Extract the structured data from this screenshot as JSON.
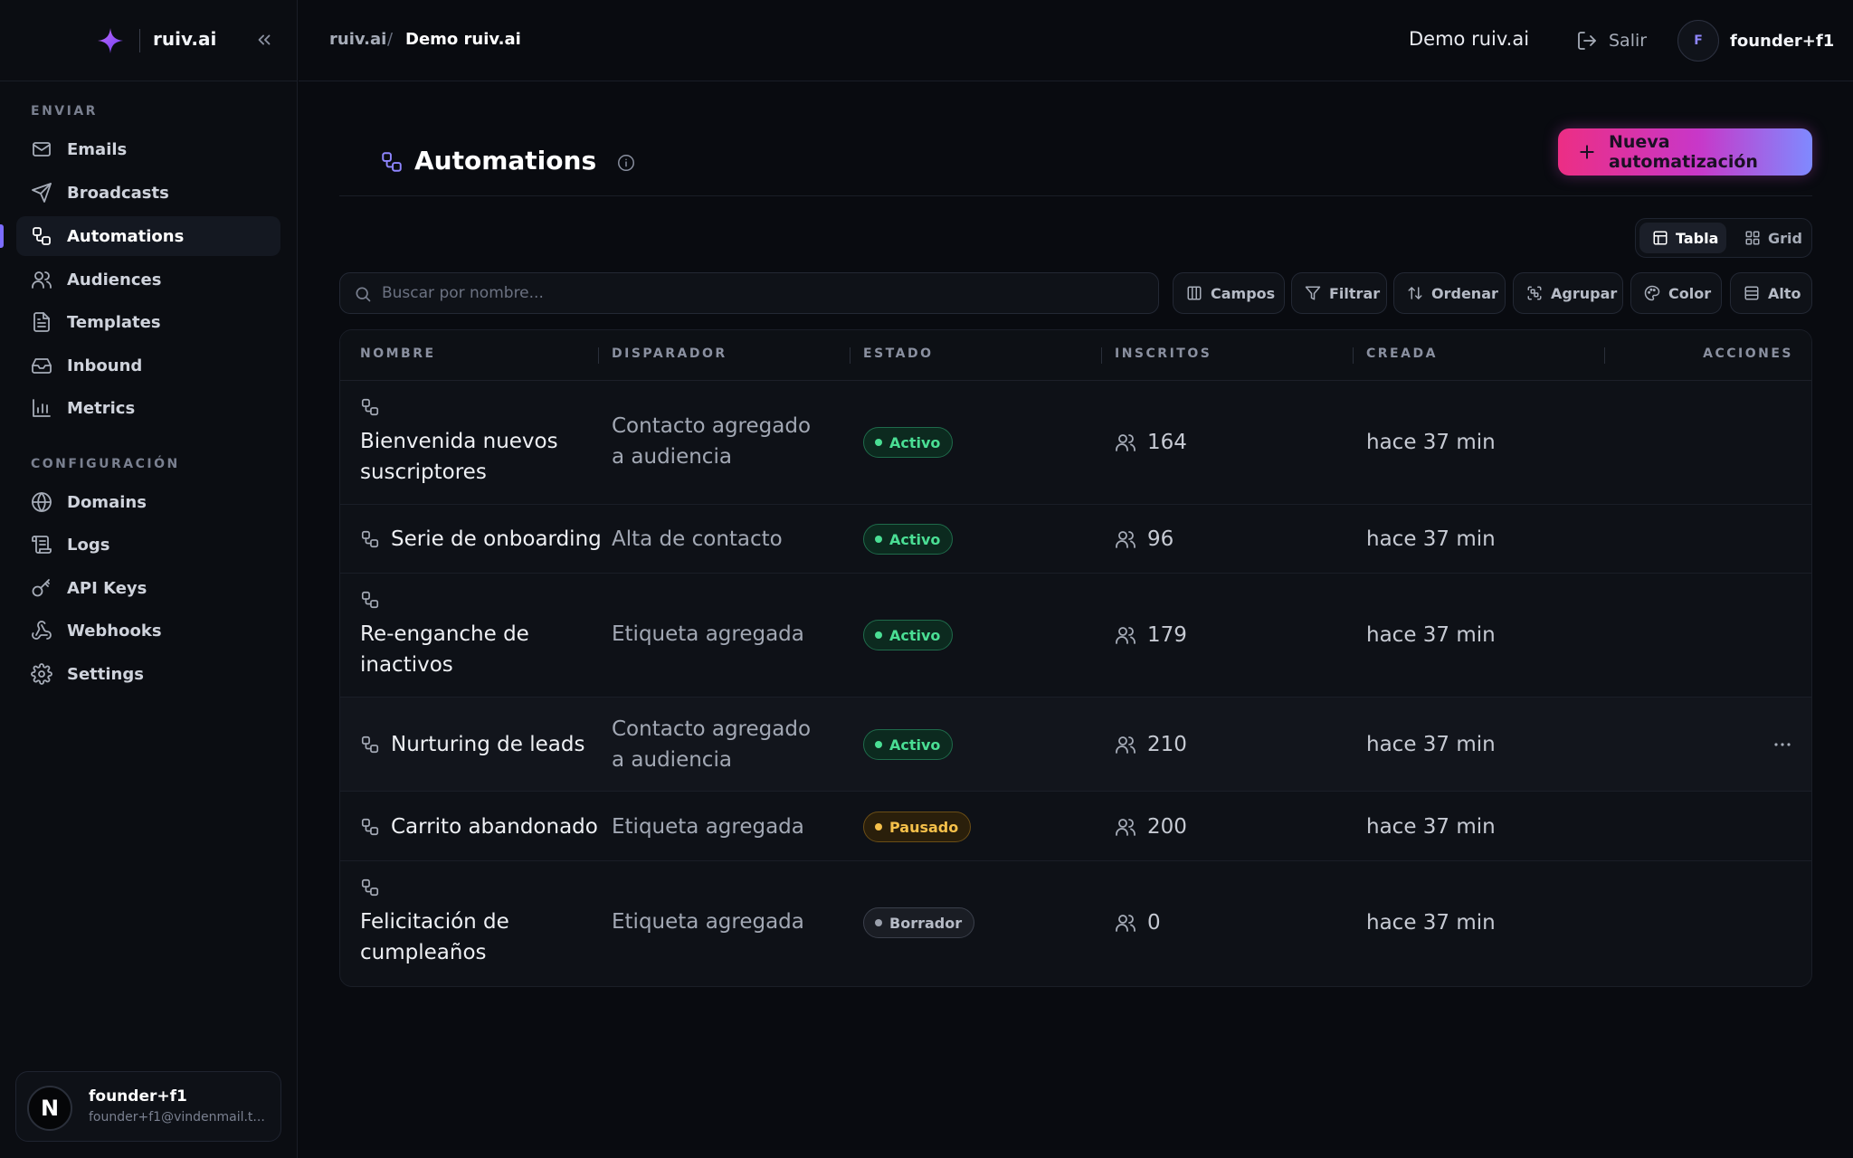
{
  "brand": {
    "name": "ruiv.ai"
  },
  "sidebar": {
    "sections": [
      {
        "label": "ENVIAR"
      },
      {
        "label": "CONFIGURACIÓN"
      }
    ],
    "items": [
      {
        "label": "Emails",
        "icon": "mail-icon"
      },
      {
        "label": "Broadcasts",
        "icon": "send-icon"
      },
      {
        "label": "Automations",
        "icon": "workflow-icon",
        "active": true
      },
      {
        "label": "Audiences",
        "icon": "users-icon"
      },
      {
        "label": "Templates",
        "icon": "file-text-icon"
      },
      {
        "label": "Inbound",
        "icon": "inbox-icon"
      },
      {
        "label": "Metrics",
        "icon": "bar-chart-icon"
      },
      {
        "label": "Domains",
        "icon": "globe-icon"
      },
      {
        "label": "Logs",
        "icon": "scroll-icon"
      },
      {
        "label": "API Keys",
        "icon": "key-icon"
      },
      {
        "label": "Webhooks",
        "icon": "webhook-icon"
      },
      {
        "label": "Settings",
        "icon": "gear-icon"
      }
    ],
    "user": {
      "initial": "N",
      "name": "founder+f1",
      "email": "founder+f1@vindenmail.t..."
    }
  },
  "topbar": {
    "breadcrumb": [
      "ruiv.ai",
      "/",
      "Demo ruiv.ai"
    ],
    "org_name": "Demo ruiv.ai",
    "logout_label": "Salir",
    "user_initial": "F",
    "user_name": "founder+f1"
  },
  "page": {
    "title": "Automations",
    "new_button_label": "Nueva automatización",
    "view_toggle": {
      "table_label": "Tabla",
      "grid_label": "Grid",
      "selected": "Tabla"
    },
    "search": {
      "placeholder": "Buscar por nombre...",
      "value": ""
    },
    "tools": [
      "Campos",
      "Filtrar",
      "Ordenar",
      "Agrupar",
      "Color",
      "Alto"
    ]
  },
  "table": {
    "columns": [
      "NOMBRE",
      "DISPARADOR",
      "ESTADO",
      "INSCRITOS",
      "CREADA",
      "ACCIONES"
    ],
    "rows": [
      {
        "name": "Bienvenida nuevos suscriptores",
        "trigger": "Contacto agregado a audiencia",
        "status": "Activo",
        "count": "164",
        "created": "hace 37 min"
      },
      {
        "name": "Serie de onboarding",
        "trigger": "Alta de contacto",
        "status": "Activo",
        "count": "96",
        "created": "hace 37 min"
      },
      {
        "name": "Re-enganche de inactivos",
        "trigger": "Etiqueta agregada",
        "status": "Activo",
        "count": "179",
        "created": "hace 37 min"
      },
      {
        "name": "Nurturing de leads",
        "trigger": "Contacto agregado a audiencia",
        "status": "Activo",
        "count": "210",
        "created": "hace 37 min"
      },
      {
        "name": "Carrito abandonado",
        "trigger": "Etiqueta agregada",
        "status": "Pausado",
        "count": "200",
        "created": "hace 37 min"
      },
      {
        "name": "Felicitación de cumpleaños",
        "trigger": "Etiqueta agregada",
        "status": "Borrador",
        "count": "0",
        "created": "hace 37 min"
      }
    ]
  },
  "colors": {
    "accent": "#7c6cff",
    "status_active": "#4ade94",
    "status_paused": "#f5c04a",
    "status_draft": "#9aa0ac",
    "gradient_start": "#ec2e84",
    "gradient_end": "#7f8aff"
  }
}
